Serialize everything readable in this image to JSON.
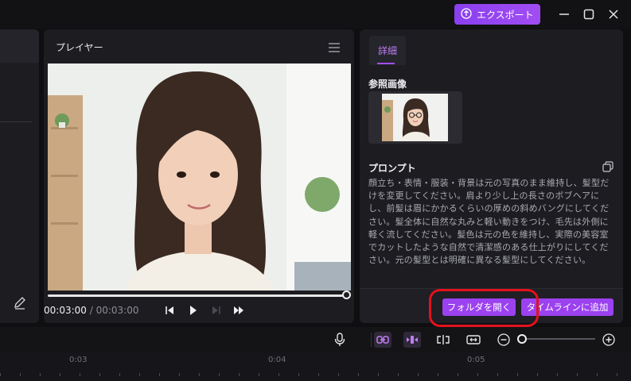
{
  "window": {
    "export_label": "エクスポート",
    "minimize_icon": "minimize-icon",
    "maximize_icon": "maximize-icon",
    "close_icon": "close-icon"
  },
  "player": {
    "title": "プレイヤー",
    "current_time": "00:03:00",
    "separator": " / ",
    "total_time": "00:03:00",
    "progress": 1.0
  },
  "details": {
    "tab_label": "詳細",
    "reference_label": "参照画像",
    "prompt_label": "プロンプト",
    "prompt_text": "顔立ち・表情・服装・背景は元の写真のまま維持し、髪型だけを変更してください。肩より少し上の長さのボブヘアにし、前髪は眉にかかるくらいの厚めの斜めバングにしてください。髪全体に自然な丸みと軽い動きをつけ、毛先は外側に軽く流してください。髪色は元の色を維持し、実際の美容室でカットしたような自然で清潔感のある仕上がりにしてください。元の髪型とは明確に異なる髪型にしてください。",
    "open_folder_label": "フォルダを開く",
    "add_timeline_label": "タイムラインに追加"
  },
  "timeline": {
    "ruler_labels": [
      "0:03",
      "0:04",
      "0:05"
    ]
  },
  "colors": {
    "accent": "#9b41ef",
    "highlight_ring": "#e3121c"
  }
}
